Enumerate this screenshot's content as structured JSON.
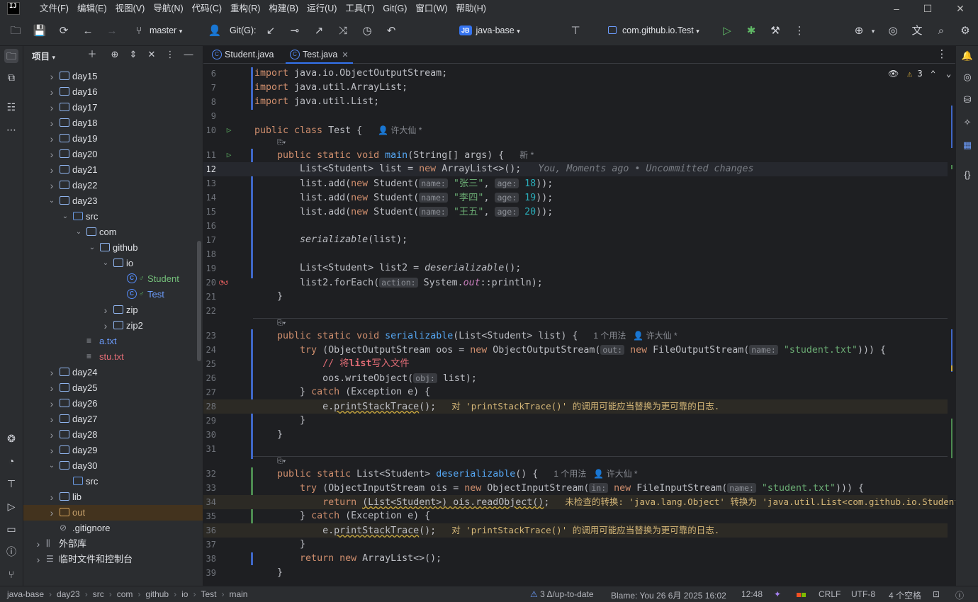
{
  "menu": [
    "文件(F)",
    "编辑(E)",
    "视图(V)",
    "导航(N)",
    "代码(C)",
    "重构(R)",
    "构建(B)",
    "运行(U)",
    "工具(T)",
    "Git(G)",
    "窗口(W)",
    "帮助(H)"
  ],
  "app_logo": "IJ",
  "toolbar": {
    "branch": "master",
    "git_label": "Git(G):",
    "project_badge": "JB",
    "project_name": "java-base",
    "run_config": "com.github.io.Test"
  },
  "project_panel": {
    "title": "项目",
    "tree": [
      {
        "label": "day15",
        "kind": "folder",
        "depth": 1,
        "expanded": false
      },
      {
        "label": "day16",
        "kind": "folder",
        "depth": 1,
        "expanded": false
      },
      {
        "label": "day17",
        "kind": "folder",
        "depth": 1,
        "expanded": false
      },
      {
        "label": "day18",
        "kind": "folder",
        "depth": 1,
        "expanded": false
      },
      {
        "label": "day19",
        "kind": "folder",
        "depth": 1,
        "expanded": false
      },
      {
        "label": "day20",
        "kind": "folder",
        "depth": 1,
        "expanded": false
      },
      {
        "label": "day21",
        "kind": "folder",
        "depth": 1,
        "expanded": false
      },
      {
        "label": "day22",
        "kind": "folder",
        "depth": 1,
        "expanded": false
      },
      {
        "label": "day23",
        "kind": "folder",
        "depth": 1,
        "expanded": true
      },
      {
        "label": "src",
        "kind": "src",
        "depth": 2,
        "expanded": true
      },
      {
        "label": "com",
        "kind": "package",
        "depth": 3,
        "expanded": true
      },
      {
        "label": "github",
        "kind": "package",
        "depth": 4,
        "expanded": true
      },
      {
        "label": "io",
        "kind": "package",
        "depth": 5,
        "expanded": true
      },
      {
        "label": "Student",
        "kind": "class",
        "depth": 6,
        "color": "green"
      },
      {
        "label": "Test",
        "kind": "class",
        "depth": 6,
        "color": "blue"
      },
      {
        "label": "zip",
        "kind": "package",
        "depth": 5,
        "expanded": false
      },
      {
        "label": "zip2",
        "kind": "package",
        "depth": 5,
        "expanded": false
      },
      {
        "label": "a.txt",
        "kind": "file",
        "depth": 3,
        "color": "blue"
      },
      {
        "label": "stu.txt",
        "kind": "file",
        "depth": 3,
        "color": "red"
      },
      {
        "label": "day24",
        "kind": "folder",
        "depth": 1,
        "expanded": false
      },
      {
        "label": "day25",
        "kind": "folder",
        "depth": 1,
        "expanded": false
      },
      {
        "label": "day26",
        "kind": "folder",
        "depth": 1,
        "expanded": false
      },
      {
        "label": "day27",
        "kind": "folder",
        "depth": 1,
        "expanded": false
      },
      {
        "label": "day28",
        "kind": "folder",
        "depth": 1,
        "expanded": false
      },
      {
        "label": "day29",
        "kind": "folder",
        "depth": 1,
        "expanded": false
      },
      {
        "label": "day30",
        "kind": "folder",
        "depth": 1,
        "expanded": true
      },
      {
        "label": "src",
        "kind": "src",
        "depth": 2
      },
      {
        "label": "lib",
        "kind": "folder",
        "depth": 1,
        "expanded": false
      },
      {
        "label": "out",
        "kind": "out",
        "depth": 1,
        "expanded": false,
        "color": "orange",
        "selected": true
      },
      {
        "label": ".gitignore",
        "kind": "ignore",
        "depth": 1
      },
      {
        "label": "外部库",
        "kind": "lib",
        "depth": 0,
        "expanded": false
      },
      {
        "label": "临时文件和控制台",
        "kind": "scratch",
        "depth": 0,
        "expanded": false
      }
    ]
  },
  "tabs": [
    {
      "label": "Student.java",
      "active": false
    },
    {
      "label": "Test.java",
      "active": true
    }
  ],
  "editor": {
    "warnings_count": "3",
    "lines": [
      {
        "n": "6",
        "html": "<span class='kw'>import</span> java.io.ObjectOutputStream;"
      },
      {
        "n": "7",
        "html": "<span class='kw'>import</span> java.util.ArrayList;"
      },
      {
        "n": "8",
        "html": "<span class='kw'>import</span> java.util.List;"
      },
      {
        "n": "9",
        "html": ""
      },
      {
        "n": "10",
        "html": "<span class='kw'>public class</span> Test { <span class='inlay'>👤 许大仙 *</span>",
        "run": true
      },
      {
        "n": "11",
        "html": "    <span class='kw'>public static void</span> <span class='fn'>main</span>(String[] args) { <span class='inlay'>新 *</span>",
        "run": true
      },
      {
        "n": "12",
        "html": "        List&lt;Student&gt; list = <span class='kw'>new</span> ArrayList&lt;&gt;();   <span class='cmt'>You, Moments ago • Uncommitted changes</span>",
        "current": true
      },
      {
        "n": "13",
        "html": "        list.add(<span class='kw'>new</span> Student(<span class='hint'>name:</span> <span class='str'>\"张三\"</span>, <span class='hint'>age:</span> <span class='num'>18</span>));"
      },
      {
        "n": "14",
        "html": "        list.add(<span class='kw'>new</span> Student(<span class='hint'>name:</span> <span class='str'>\"李四\"</span>, <span class='hint'>age:</span> <span class='num'>19</span>));"
      },
      {
        "n": "15",
        "html": "        list.add(<span class='kw'>new</span> Student(<span class='hint'>name:</span> <span class='str'>\"王五\"</span>, <span class='hint'>age:</span> <span class='num'>20</span>));"
      },
      {
        "n": "16",
        "html": ""
      },
      {
        "n": "17",
        "html": "        <span class='it'>serializable</span>(list);"
      },
      {
        "n": "18",
        "html": ""
      },
      {
        "n": "19",
        "html": "        List&lt;Student&gt; list2 = <span class='it'>deserializable</span>();"
      },
      {
        "n": "20",
        "html": "        list2.forEach(<span class='hint'>action:</span> System.<span class='fld it'>out</span>::println);",
        "bp": true
      },
      {
        "n": "21",
        "html": "    }"
      },
      {
        "n": "22",
        "html": ""
      },
      {
        "n": "23",
        "html": "    <span class='kw'>public static void</span> <span class='fn'>serializable</span>(List&lt;Student&gt; list) { <span class='inlay'>1 个用法   👤 许大仙 *</span>"
      },
      {
        "n": "24",
        "html": "        <span class='kw'>try</span> (ObjectOutputStream oos = <span class='kw'>new</span> ObjectOutputStream(<span class='hint'>out:</span> <span class='kw'>new</span> FileOutputStream(<span class='hint'>name:</span> <span class='str'>\"student.txt\"</span>))) {"
      },
      {
        "n": "25",
        "html": "            <span class='red-cmt'>// 将<b>list</b>写入文件</span>"
      },
      {
        "n": "26",
        "html": "            oos.writeObject(<span class='hint'>obj:</span> list);"
      },
      {
        "n": "27",
        "html": "        } <span class='kw'>catch</span> (Exception e) {"
      },
      {
        "n": "28",
        "html": "            e.<span class='squig'>printStackTrace</span>(); <span class='warn-txt'>对 'printStackTrace()' 的调用可能应当替换为更可靠的日志.</span>",
        "warn": true
      },
      {
        "n": "29",
        "html": "        }"
      },
      {
        "n": "30",
        "html": "    }"
      },
      {
        "n": "31",
        "html": ""
      },
      {
        "n": "32",
        "html": "    <span class='kw'>public static</span> List&lt;Student&gt; <span class='fn'>deserializable</span>() { <span class='inlay'>1 个用法   👤 许大仙 *</span>"
      },
      {
        "n": "33",
        "html": "        <span class='kw'>try</span> (ObjectInputStream ois = <span class='kw'>new</span> ObjectInputStream(<span class='hint'>in:</span> <span class='kw'>new</span> FileInputStream(<span class='hint'>name:</span> <span class='str'>\"student.txt\"</span>))) {"
      },
      {
        "n": "34",
        "html": "            <span class='kw'>return</span> <span class='squig'>(List&lt;Student&gt;) ois.readObject()</span>; <span class='warn-txt'>未检查的转换: 'java.lang.Object' 转换为 'java.util.List&lt;com.github.io.Student&gt;'.</span>",
        "warn": true
      },
      {
        "n": "35",
        "html": "        } <span class='kw'>catch</span> (Exception e) {"
      },
      {
        "n": "36",
        "html": "            e.<span class='squig'>printStackTrace</span>(); <span class='warn-txt'>对 'printStackTrace()' 的调用可能应当替换为更可靠的日志.</span>",
        "warn": true
      },
      {
        "n": "37",
        "html": "        }"
      },
      {
        "n": "38",
        "html": "        <span class='kw'>return new</span> ArrayList&lt;&gt;();"
      },
      {
        "n": "39",
        "html": "    }"
      }
    ]
  },
  "statusbar": {
    "breadcrumb": [
      "java-base",
      "day23",
      "src",
      "com",
      "github",
      "io",
      "Test",
      "main"
    ],
    "git_status": "3 Δ/up-to-date",
    "blame": "Blame: You 26 6月 2025 16:02",
    "position": "12:48",
    "line_sep": "CRLF",
    "encoding": "UTF-8",
    "indent": "4 个空格"
  }
}
